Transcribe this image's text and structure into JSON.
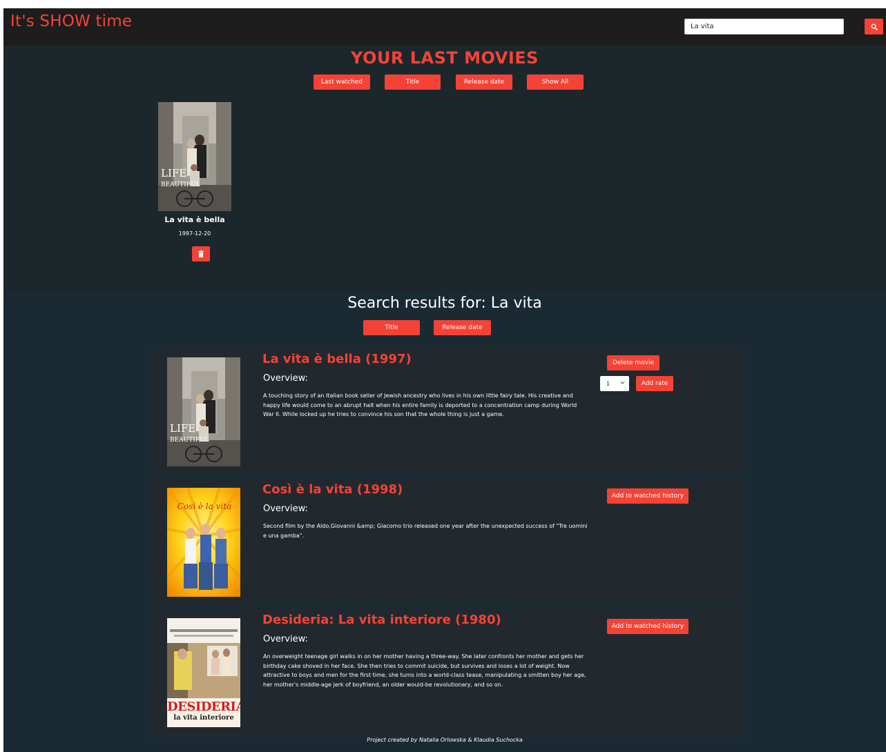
{
  "header": {
    "brand": "It's SHOW time",
    "search_value": "La vita"
  },
  "last_movies": {
    "title": "YOUR LAST MOVIES",
    "sort_buttons": [
      "Last watched",
      "Title",
      "Release date",
      "Show All"
    ],
    "cards": [
      {
        "title": "La vita è bella",
        "date": "1997-12-20",
        "poster_text": "LIFE IS BEAUTIFUL"
      }
    ]
  },
  "results": {
    "title": "Search results for: La vita",
    "sort_buttons": [
      "Title",
      "Release date"
    ],
    "overview_label": "Overview:",
    "items": [
      {
        "title": "La vita è bella (1997)",
        "overview": "A touching story of an Italian book seller of Jewish ancestry who lives in his own little fairy tale. His creative and happy life would come to an abrupt halt when his entire family is deported to a concentration camp during World War II. While locked up he tries to convince his son that the whole thing is just a game.",
        "primary_action": "Delete movie",
        "rate_value": "1",
        "rate_action": "Add rate",
        "poster_text": "LIFE IS BEAUTIFUL"
      },
      {
        "title": "Così è la vita (1998)",
        "overview": "Second film by the Aldo,Giovanni &amp; Giacomo trio released one year after the unexpected success of \"Tre uomini e una gamba\".",
        "primary_action": "Add to watched history",
        "poster_text": "Così è la vita"
      },
      {
        "title": "Desideria: La vita interiore (1980)",
        "overview": "An overweight teenage girl walks in on her mother having a three-way. She later confronts her mother and gets her birthday cake shoved in her face. She then tries to commit suicide, but survives and loses a lot of weight. Now attractive to boys and men for the first time, she turns into a world-class tease, manipulating a smitten boy her age, her mother's middle-age jerk of boyfriend, an older would-be revolutionary, and so on.",
        "primary_action": "Add to watched history",
        "poster_text_1": "DESIDERIA",
        "poster_text_2": "la vita interiore"
      }
    ]
  },
  "footer": {
    "credit": "Project created by Natalia Orlowska & Klaudia Suchocka"
  },
  "colors": {
    "accent": "#f44336",
    "header_bg": "#1d1d1d",
    "section_bg": "#1c272c",
    "card_bg": "#22292e"
  }
}
